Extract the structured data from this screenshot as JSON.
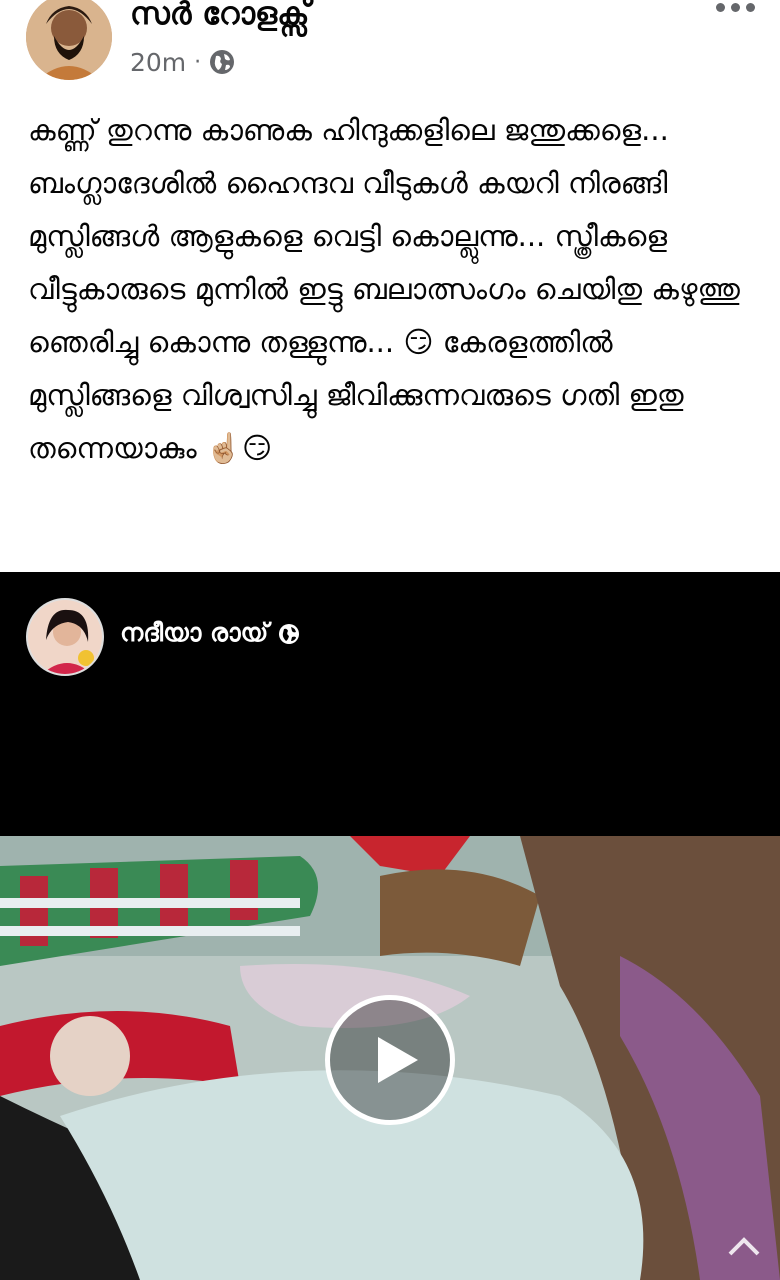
{
  "post": {
    "author": "സർ റോളക്സ്",
    "time": "20m",
    "separator": "·",
    "privacy_icon": "globe-icon",
    "more_icon": "more-horizontal-icon",
    "text": "കണ്ണ് തുറന്നു കാണുക ഹിന്ദുക്കളിലെ ജന്തുക്കളെ... ബംഗ്ലാദേശിൽ ഹൈന്ദവ വീടുകൾ കയറി നിരങ്ങി മുസ്ലിങ്ങൾ ആളുകളെ വെട്ടി കൊല്ലുന്നു... സ്ത്രീകളെ വീട്ടുകാരുടെ മുന്നിൽ ഇട്ടു ബലാത്സംഗം ചെയിതു കഴുത്തു ഞെരിച്ചു കൊന്നു തള്ളുന്നു... 😏 കേരളത്തിൽ മുസ്ലിങ്ങളെ വിശ്വസിച്ചു ജീവിക്കുന്നവരുടെ ഗതി ഇതു തന്നെയാകും ☝🏼😏"
  },
  "shared": {
    "author": "നദീയാ രായ്",
    "privacy_icon": "globe-icon",
    "play_icon": "play-icon"
  },
  "colors": {
    "text": "#050505",
    "meta": "#65676b",
    "video_bg": "#000000"
  }
}
